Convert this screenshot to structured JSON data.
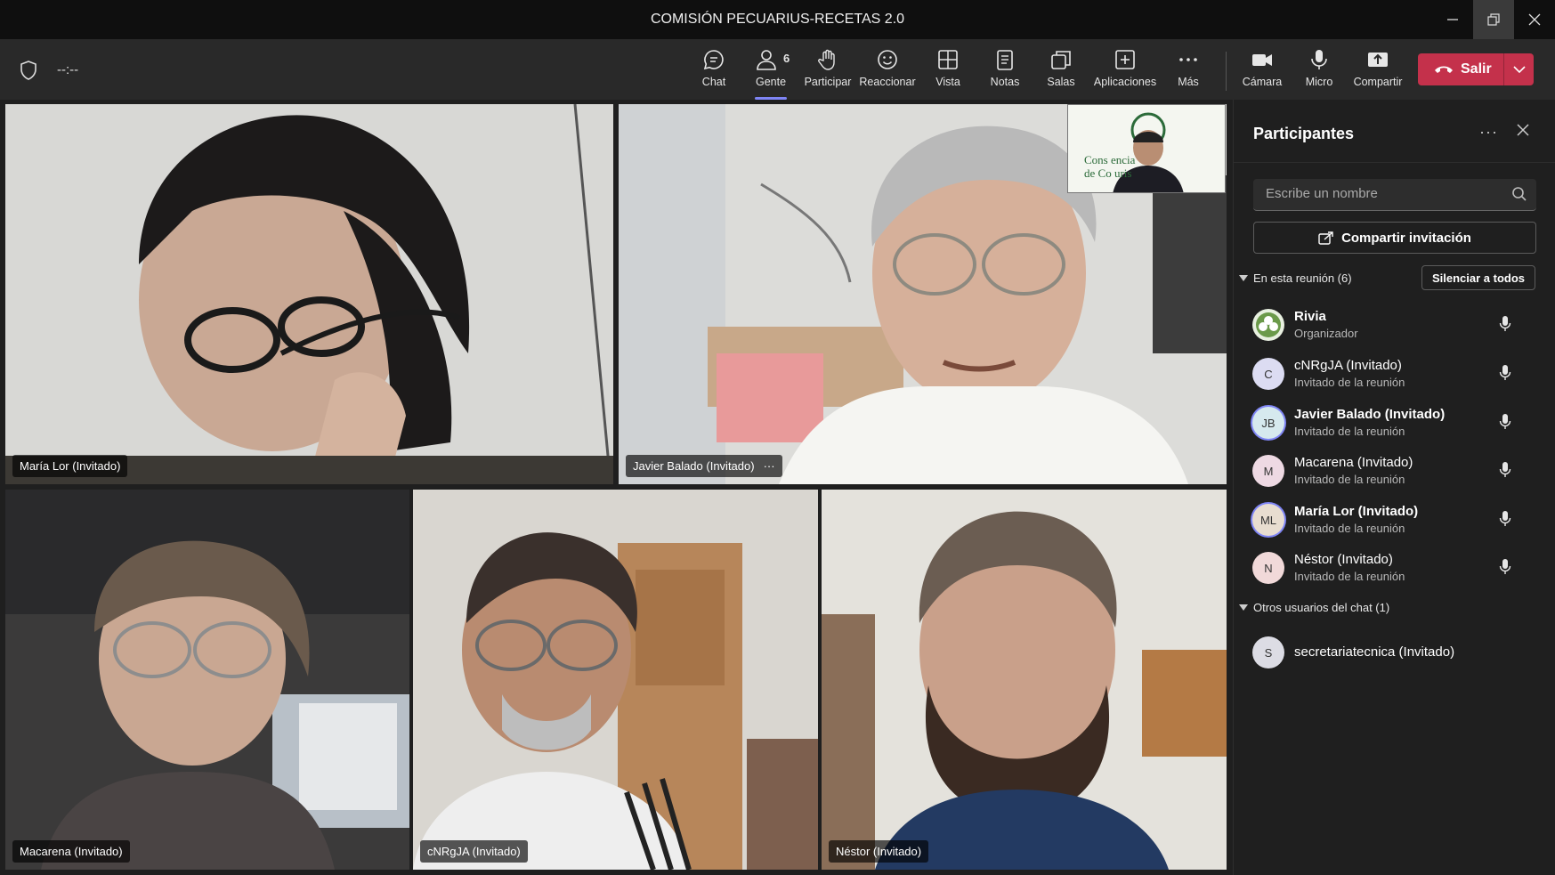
{
  "window": {
    "title": "COMISIÓN PECUARIUS-RECETAS 2.0"
  },
  "toolbar": {
    "timer": "--:--",
    "people_count": "6",
    "buttons": [
      {
        "label": "Chat",
        "icon": "chat-icon"
      },
      {
        "label": "Gente",
        "icon": "people-icon"
      },
      {
        "label": "Participar",
        "icon": "raise-hand-icon"
      },
      {
        "label": "Reaccionar",
        "icon": "react-icon"
      },
      {
        "label": "Vista",
        "icon": "view-icon"
      },
      {
        "label": "Notas",
        "icon": "notes-icon"
      },
      {
        "label": "Salas",
        "icon": "rooms-icon"
      },
      {
        "label": "Aplicaciones",
        "icon": "apps-icon"
      },
      {
        "label": "Más",
        "icon": "more-icon"
      },
      {
        "label": "Cámara",
        "icon": "camera-icon"
      },
      {
        "label": "Micro",
        "icon": "mic-icon"
      },
      {
        "label": "Compartir",
        "icon": "share-icon"
      }
    ],
    "leave_label": "Salir",
    "active_tab": "Gente"
  },
  "video": {
    "tiles": [
      {
        "name": "María Lor (Invitado)",
        "speaking": true
      },
      {
        "name": "Javier Balado (Invitado)",
        "speaking": true
      },
      {
        "name": "Macarena (Invitado)",
        "speaking": false
      },
      {
        "name": "cNRgJA (Invitado)",
        "speaking": false
      },
      {
        "name": "Néstor (Invitado)",
        "speaking": false
      }
    ],
    "selfview_logo_line1": "Cons  encia",
    "selfview_logo_line2": "de Co          uris"
  },
  "panel": {
    "title": "Participantes",
    "search_placeholder": "Escribe un nombre",
    "invite_label": "Compartir invitación",
    "in_meeting_label": "En esta reunión (6)",
    "mute_all_label": "Silenciar a todos",
    "participants": [
      {
        "name": "Rivia",
        "role": "Organizador",
        "initials": "",
        "avatar_color": "#e8f0e0"
      },
      {
        "name": "cNRgJA (Invitado)",
        "role": "Invitado de la reunión",
        "initials": "C",
        "avatar_color": "#dcdcf2"
      },
      {
        "name": "Javier Balado (Invitado)",
        "role": "Invitado de la reunión",
        "initials": "JB",
        "avatar_color": "#d6e9ee"
      },
      {
        "name": "Macarena (Invitado)",
        "role": "Invitado de la reunión",
        "initials": "M",
        "avatar_color": "#eed9e3"
      },
      {
        "name": "María Lor (Invitado)",
        "role": "Invitado de la reunión",
        "initials": "ML",
        "avatar_color": "#e8ddd0"
      },
      {
        "name": "Néstor (Invitado)",
        "role": "Invitado de la reunión",
        "initials": "N",
        "avatar_color": "#f1d9d9"
      }
    ],
    "other_users_label": "Otros usuarios del chat (1)",
    "other_users": [
      {
        "name": "secretariatecnica (Invitado)",
        "initials": "S",
        "avatar_color": "#dcdce4"
      }
    ]
  },
  "colors": {
    "accent": "#7f85f5",
    "leave": "#c4314b",
    "panel_bg": "#1f1f1f"
  }
}
